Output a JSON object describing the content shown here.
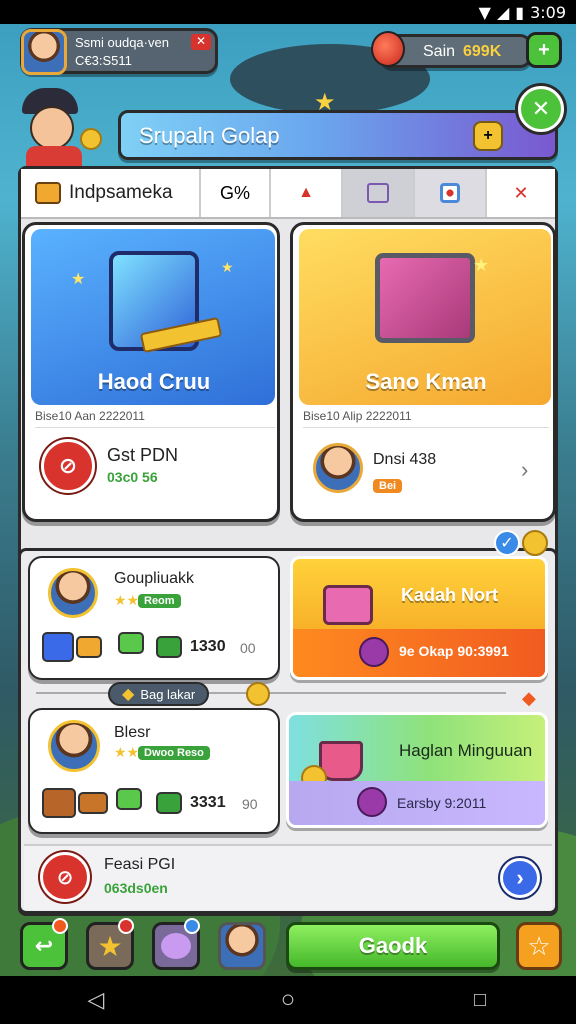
{
  "status_bar": {
    "time": "3:09"
  },
  "profile": {
    "name": "Ssmi oudqa·ven",
    "id": "C€3:S511"
  },
  "currency": {
    "label": "Sain",
    "value": "699K"
  },
  "banner": {
    "title": "Srupaln Golap"
  },
  "tabs": {
    "title": "Indpsameka",
    "percent": "G%"
  },
  "offer_left": {
    "title": "Haod Cruu",
    "meta": "Bise10 Aan 2222011",
    "name": "Gst PDN",
    "sub": "03c0 56"
  },
  "offer_right": {
    "title": "Sano Kman",
    "meta": "Bise10 Alip 2222011",
    "name": "Dnsi 438",
    "sub": "Bei"
  },
  "row1_left": {
    "name": "Goupliuakk",
    "tag": "Reom",
    "count": "1330",
    "suffix": "00"
  },
  "row1_right": {
    "title": "Kadah Nort",
    "sub": "9e Okap 90:3991"
  },
  "divider": {
    "label": "Bag lakar"
  },
  "row2_left": {
    "name": "Blesr",
    "tag": "Dwoo Reso",
    "count": "3331",
    "suffix": "90"
  },
  "row2_right": {
    "title": "Haglan Minguuan",
    "sub": "Earsby 9:2011"
  },
  "bottom_row": {
    "name": "Feasi PGI",
    "sub": "063ds0en"
  },
  "bottom_bar": {
    "main_button": "Gaodk"
  },
  "colors": {
    "accent_green": "#4cc23a",
    "banner_purple": "#7a58d0",
    "banner_blue": "#69b9ef",
    "cta_orange": "#f6a020",
    "badge_red": "#d8332c"
  },
  "icons": [
    "wifi-icon",
    "signal-icon",
    "battery-icon",
    "close-icon",
    "plus-icon",
    "check-icon",
    "chevron-right-icon",
    "star-icon",
    "back-icon",
    "home-icon",
    "recents-icon"
  ]
}
